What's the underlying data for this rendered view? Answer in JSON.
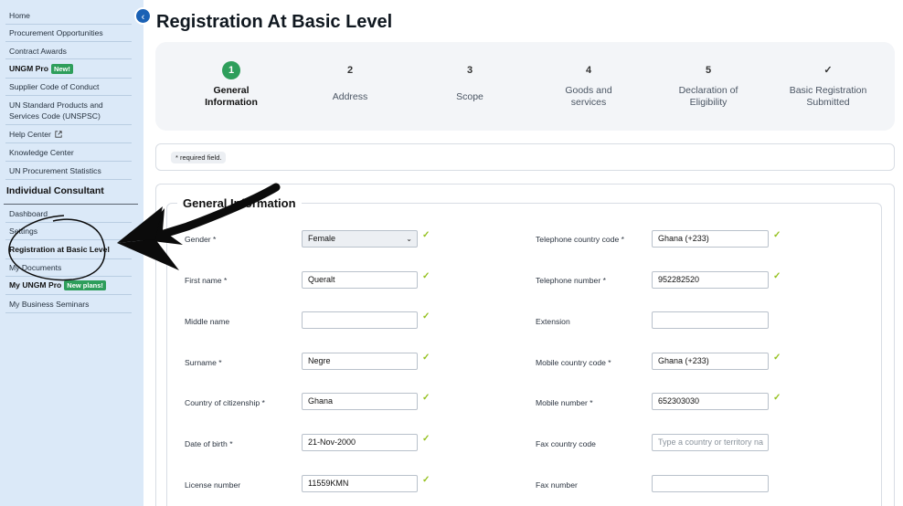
{
  "sidebar": {
    "items": [
      {
        "label": "Home"
      },
      {
        "label": "Procurement Opportunities"
      },
      {
        "label": "Contract Awards"
      },
      {
        "label": "UNGM Pro",
        "badge": "New!"
      },
      {
        "label": "Supplier Code of Conduct"
      },
      {
        "label": "UN Standard Products and Services Code (UNSPSC)"
      },
      {
        "label": "Help Center"
      },
      {
        "label": "Knowledge Center"
      },
      {
        "label": "UN Procurement Statistics"
      }
    ],
    "section_heading": "Individual Consultant",
    "section_items": [
      {
        "label": "Dashboard"
      },
      {
        "label": "Settings"
      },
      {
        "label": "Registration at Basic Level"
      },
      {
        "label": "My Documents"
      },
      {
        "label": "My UNGM Pro",
        "badge": "New plans!"
      },
      {
        "label": "My Business Seminars"
      }
    ],
    "collapse_icon": "chevron-left-icon"
  },
  "page_title": "Registration At Basic Level",
  "stepper": {
    "steps": [
      {
        "num": "1",
        "label": "General Information",
        "active": true
      },
      {
        "num": "2",
        "label": "Address"
      },
      {
        "num": "3",
        "label": "Scope"
      },
      {
        "num": "4",
        "label": "Goods and services"
      },
      {
        "num": "5",
        "label": "Declaration of Eligibility"
      },
      {
        "num": "✓",
        "label": "Basic Registration Submitted"
      }
    ],
    "active_color": "#2e9e5b"
  },
  "required_note": "* required field.",
  "form": {
    "section_title": "General Information",
    "left": {
      "gender_label": "Gender *",
      "gender_value": "Female",
      "first_name_label": "First name *",
      "first_name_value": "Queralt",
      "middle_name_label": "Middle name",
      "middle_name_value": "",
      "surname_label": "Surname *",
      "surname_value": "Negre",
      "citizenship_label": "Country of citizenship *",
      "citizenship_value": "Ghana",
      "dob_label": "Date of birth *",
      "dob_value": "21-Nov-2000",
      "license_label": "License number",
      "license_value": "11559KMN"
    },
    "right": {
      "tel_code_label": "Telephone country code *",
      "tel_code_value": "Ghana (+233)",
      "tel_number_label": "Telephone number *",
      "tel_number_value": "952282520",
      "extension_label": "Extension",
      "extension_value": "",
      "mobile_code_label": "Mobile country code *",
      "mobile_code_value": "Ghana (+233)",
      "mobile_number_label": "Mobile number *",
      "mobile_number_value": "652303030",
      "fax_code_label": "Fax country code",
      "fax_code_placeholder": "Type a country or territory na",
      "fax_number_label": "Fax number",
      "fax_number_value": ""
    },
    "valid_mark": "✓",
    "valid_color": "#95c11f"
  }
}
